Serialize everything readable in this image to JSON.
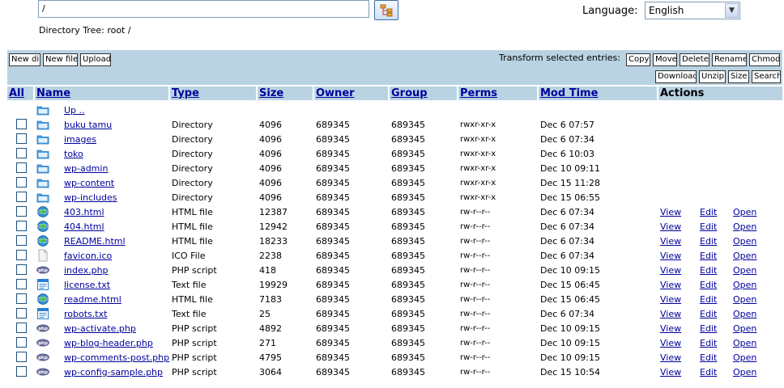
{
  "top": {
    "dir_value": "/",
    "dir_tree_label": "Directory Tree: root /",
    "language_label": "Language:",
    "language_selected": "English"
  },
  "toolbar": {
    "new_dir": "New dir",
    "new_file": "New file",
    "upload": "Upload",
    "transform_label": "Transform selected entries:",
    "copy": "Copy",
    "move": "Move",
    "delete": "Delete",
    "rename": "Rename",
    "chmod": "Chmod",
    "download": "Download",
    "unzip": "Unzip",
    "size": "Size",
    "search": "Search"
  },
  "table": {
    "headers": {
      "all": "All",
      "name": "Name",
      "type": "Type",
      "size": "Size",
      "owner": "Owner",
      "group": "Group",
      "perms": "Perms",
      "mod_time": "Mod Time",
      "actions": "Actions"
    },
    "up_label": "Up ..",
    "action_labels": {
      "view": "View",
      "edit": "Edit",
      "open": "Open"
    },
    "rows": [
      {
        "name": "buku tamu",
        "type": "Directory",
        "size": "4096",
        "owner": "689345",
        "group": "689345",
        "perms": "rwxr-xr-x",
        "mtime": "Dec 6 07:57",
        "icon": "folder-icon",
        "actions": false
      },
      {
        "name": "images",
        "type": "Directory",
        "size": "4096",
        "owner": "689345",
        "group": "689345",
        "perms": "rwxr-xr-x",
        "mtime": "Dec 6 07:34",
        "icon": "folder-icon",
        "actions": false
      },
      {
        "name": "toko",
        "type": "Directory",
        "size": "4096",
        "owner": "689345",
        "group": "689345",
        "perms": "rwxr-xr-x",
        "mtime": "Dec 6 10:03",
        "icon": "folder-icon",
        "actions": false
      },
      {
        "name": "wp-admin",
        "type": "Directory",
        "size": "4096",
        "owner": "689345",
        "group": "689345",
        "perms": "rwxr-xr-x",
        "mtime": "Dec 10 09:11",
        "icon": "folder-icon",
        "actions": false
      },
      {
        "name": "wp-content",
        "type": "Directory",
        "size": "4096",
        "owner": "689345",
        "group": "689345",
        "perms": "rwxr-xr-x",
        "mtime": "Dec 15 11:28",
        "icon": "folder-icon",
        "actions": false
      },
      {
        "name": "wp-includes",
        "type": "Directory",
        "size": "4096",
        "owner": "689345",
        "group": "689345",
        "perms": "rwxr-xr-x",
        "mtime": "Dec 15 06:55",
        "icon": "folder-icon",
        "actions": false
      },
      {
        "name": "403.html",
        "type": "HTML file",
        "size": "12387",
        "owner": "689345",
        "group": "689345",
        "perms": "rw-r--r--",
        "mtime": "Dec 6 07:34",
        "icon": "globe-icon",
        "actions": true
      },
      {
        "name": "404.html",
        "type": "HTML file",
        "size": "12942",
        "owner": "689345",
        "group": "689345",
        "perms": "rw-r--r--",
        "mtime": "Dec 6 07:34",
        "icon": "globe-icon",
        "actions": true
      },
      {
        "name": "README.html",
        "type": "HTML file",
        "size": "18233",
        "owner": "689345",
        "group": "689345",
        "perms": "rw-r--r--",
        "mtime": "Dec 6 07:34",
        "icon": "globe-icon",
        "actions": true
      },
      {
        "name": "favicon.ico",
        "type": "ICO File",
        "size": "2238",
        "owner": "689345",
        "group": "689345",
        "perms": "rw-r--r--",
        "mtime": "Dec 6 07:34",
        "icon": "blank-file-icon",
        "actions": true
      },
      {
        "name": "index.php",
        "type": "PHP script",
        "size": "418",
        "owner": "689345",
        "group": "689345",
        "perms": "rw-r--r--",
        "mtime": "Dec 10 09:15",
        "icon": "php-icon",
        "actions": true
      },
      {
        "name": "license.txt",
        "type": "Text file",
        "size": "19929",
        "owner": "689345",
        "group": "689345",
        "perms": "rw-r--r--",
        "mtime": "Dec 15 06:45",
        "icon": "text-file-icon",
        "actions": true
      },
      {
        "name": "readme.html",
        "type": "HTML file",
        "size": "7183",
        "owner": "689345",
        "group": "689345",
        "perms": "rw-r--r--",
        "mtime": "Dec 15 06:45",
        "icon": "globe-icon",
        "actions": true
      },
      {
        "name": "robots.txt",
        "type": "Text file",
        "size": "25",
        "owner": "689345",
        "group": "689345",
        "perms": "rw-r--r--",
        "mtime": "Dec 6 07:34",
        "icon": "text-file-icon",
        "actions": true
      },
      {
        "name": "wp-activate.php",
        "type": "PHP script",
        "size": "4892",
        "owner": "689345",
        "group": "689345",
        "perms": "rw-r--r--",
        "mtime": "Dec 10 09:15",
        "icon": "php-icon",
        "actions": true
      },
      {
        "name": "wp-blog-header.php",
        "type": "PHP script",
        "size": "271",
        "owner": "689345",
        "group": "689345",
        "perms": "rw-r--r--",
        "mtime": "Dec 10 09:15",
        "icon": "php-icon",
        "actions": true
      },
      {
        "name": "wp-comments-post.php",
        "type": "PHP script",
        "size": "4795",
        "owner": "689345",
        "group": "689345",
        "perms": "rw-r--r--",
        "mtime": "Dec 10 09:15",
        "icon": "php-icon",
        "actions": true
      },
      {
        "name": "wp-config-sample.php",
        "type": "PHP script",
        "size": "3064",
        "owner": "689345",
        "group": "689345",
        "perms": "rw-r--r--",
        "mtime": "Dec 15 10:54",
        "icon": "php-icon",
        "actions": true
      }
    ]
  }
}
